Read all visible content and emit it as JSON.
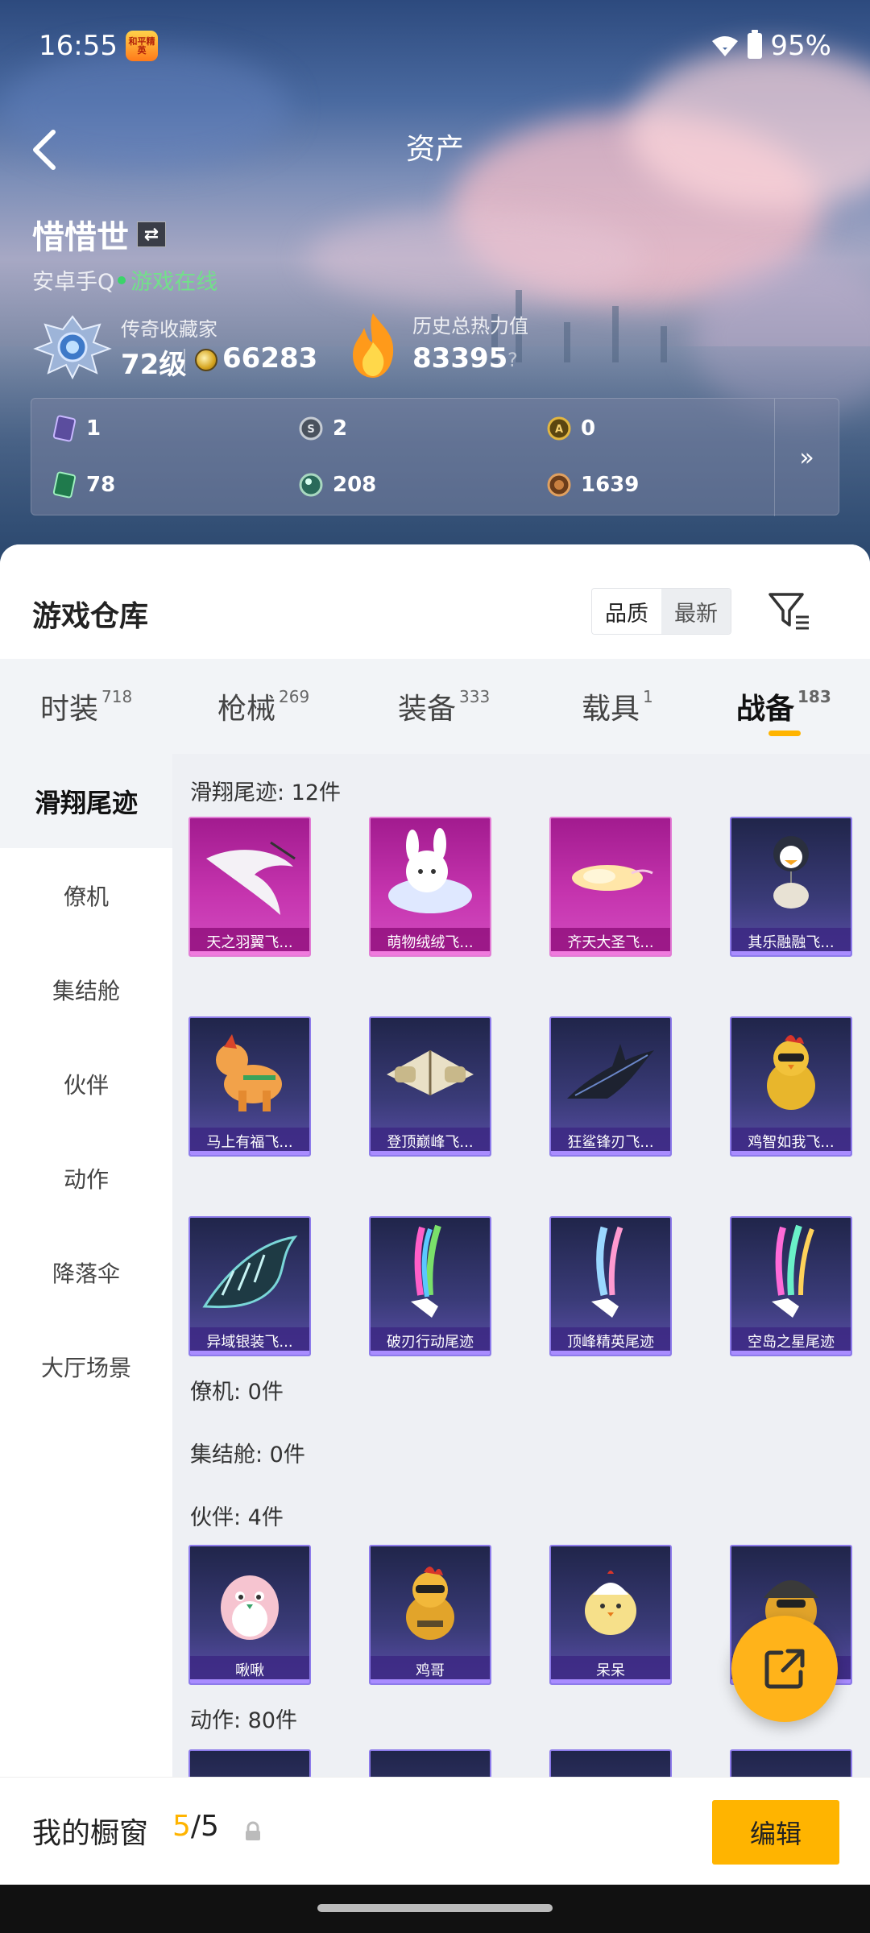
{
  "status": {
    "time": "16:55",
    "app_badge": "和平精英",
    "battery": "95%"
  },
  "header": {
    "title": "资产"
  },
  "profile": {
    "name": "惜惜世",
    "platform": "安卓手Q",
    "online_text": "游戏在线"
  },
  "stats": {
    "collector_label": "传奇收藏家",
    "level": "72级",
    "coins": "66283",
    "heat_label": "历史总热力值",
    "heat_value": "83395",
    "help": "?"
  },
  "currencies": [
    {
      "icon": "ticket-card-icon",
      "value": "1"
    },
    {
      "icon": "silver-coin-icon",
      "value": "2"
    },
    {
      "icon": "gold-coin-icon",
      "value": "0"
    },
    {
      "icon": "green-card-icon",
      "value": "78"
    },
    {
      "icon": "green-gem-icon",
      "value": "208"
    },
    {
      "icon": "bronze-coin-icon",
      "value": "1639"
    }
  ],
  "warehouse": {
    "title": "游戏仓库",
    "sort_quality": "品质",
    "sort_latest": "最新"
  },
  "tabs": [
    {
      "label": "时装",
      "count": "718"
    },
    {
      "label": "枪械",
      "count": "269"
    },
    {
      "label": "装备",
      "count": "333"
    },
    {
      "label": "载具",
      "count": "1"
    },
    {
      "label": "战备",
      "count": "183",
      "active": true
    }
  ],
  "side_nav": [
    "滑翔尾迹",
    "僚机",
    "集结舱",
    "伙伴",
    "动作",
    "降落伞",
    "大厅场景"
  ],
  "sections": {
    "glide": {
      "title": "滑翔尾迹: 12件",
      "items": [
        "天之羽翼飞...",
        "萌物绒绒飞...",
        "齐天大圣飞...",
        "其乐融融飞...",
        "马上有福飞...",
        "登顶巅峰飞...",
        "狂鲨锋刃飞...",
        "鸡智如我飞...",
        "异域银装飞...",
        "破刃行动尾迹",
        "顶峰精英尾迹",
        "空岛之星尾迹"
      ]
    },
    "wingman": {
      "title": "僚机: 0件"
    },
    "capsule": {
      "title": "集结舱: 0件"
    },
    "partner": {
      "title": "伙伴: 4件",
      "items": [
        "啾啾",
        "鸡哥",
        "呆呆",
        ""
      ]
    },
    "action": {
      "title": "动作: 80件"
    }
  },
  "showcase": {
    "title": "我的橱窗",
    "current": "5",
    "slash": "/",
    "total": "5",
    "edit": "编辑"
  },
  "colors": {
    "accent": "#ffb400",
    "card_purple": "#3a3b78",
    "card_pink": "#c534ae"
  }
}
